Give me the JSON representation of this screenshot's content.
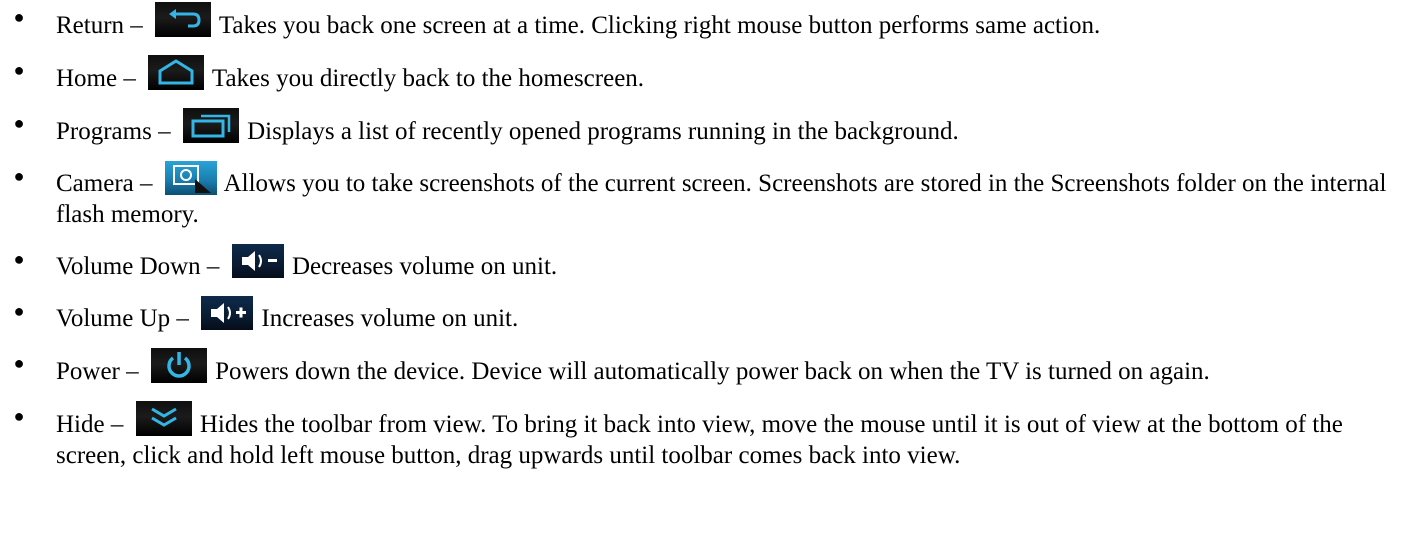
{
  "colors": {
    "icon_background": "#141414",
    "icon_glyph": "#33b5e5",
    "text": "#000000"
  },
  "items": [
    {
      "label": "Return –",
      "icon": "return-arrow-icon",
      "desc": "Takes you back one screen at a time.  Clicking right mouse button performs same action."
    },
    {
      "label": "Home –",
      "icon": "home-icon",
      "desc": "Takes you directly back to the homescreen."
    },
    {
      "label": "Programs –",
      "icon": "recent-apps-icon",
      "desc": "Displays a list of recently opened programs running in the background."
    },
    {
      "label": "Camera –",
      "icon": "screenshot-camera-icon",
      "desc": "Allows you to take screenshots of the current screen.  Screenshots are stored in the Screenshots folder on the internal flash memory."
    },
    {
      "label": "Volume Down –",
      "icon": "volume-down-icon",
      "desc": "Decreases volume on unit."
    },
    {
      "label": "Volume Up –",
      "icon": "volume-up-icon",
      "desc": "Increases volume on unit."
    },
    {
      "label": "Power –",
      "icon": "power-icon",
      "desc": "Powers down the device.  Device will automatically power back on when the TV is turned on again."
    },
    {
      "label": "Hide –",
      "icon": "hide-chevron-icon",
      "desc": "Hides the toolbar from view.  To bring it back into view, move the mouse until it is out of view at the bottom of the screen, click and hold left mouse button, drag upwards until toolbar comes back into view."
    }
  ]
}
